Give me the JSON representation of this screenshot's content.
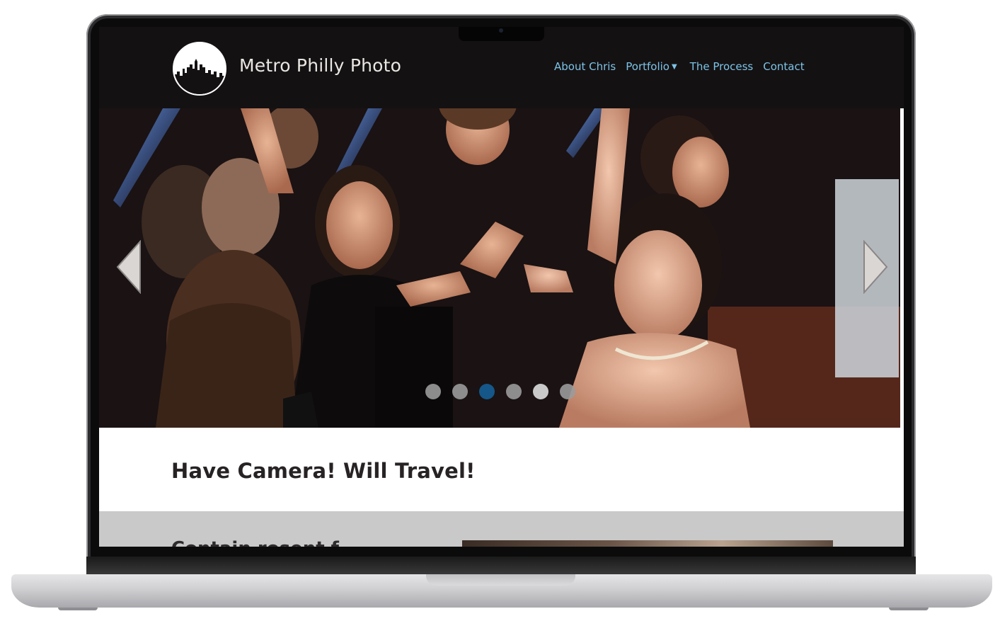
{
  "site": {
    "brand": "Metro Philly Photo",
    "nav": [
      {
        "label": "About Chris",
        "has_dropdown": false
      },
      {
        "label": "Portfolio",
        "has_dropdown": true
      },
      {
        "label": "The Process",
        "has_dropdown": false
      },
      {
        "label": "Contact",
        "has_dropdown": false
      }
    ],
    "dropdown_caret": "▼",
    "slider": {
      "dots": 6,
      "active_index": 2,
      "prev_icon": "chevron-left-icon",
      "next_icon": "chevron-right-icon"
    },
    "tagline": "Have Camera! Will Travel!",
    "section_heading_partial": "Contain rosent f"
  },
  "colors": {
    "header_bg": "#141112",
    "nav_link": "#7cc4e8",
    "active_dot": "#155f96",
    "gray_section": "#c9c9c9"
  }
}
